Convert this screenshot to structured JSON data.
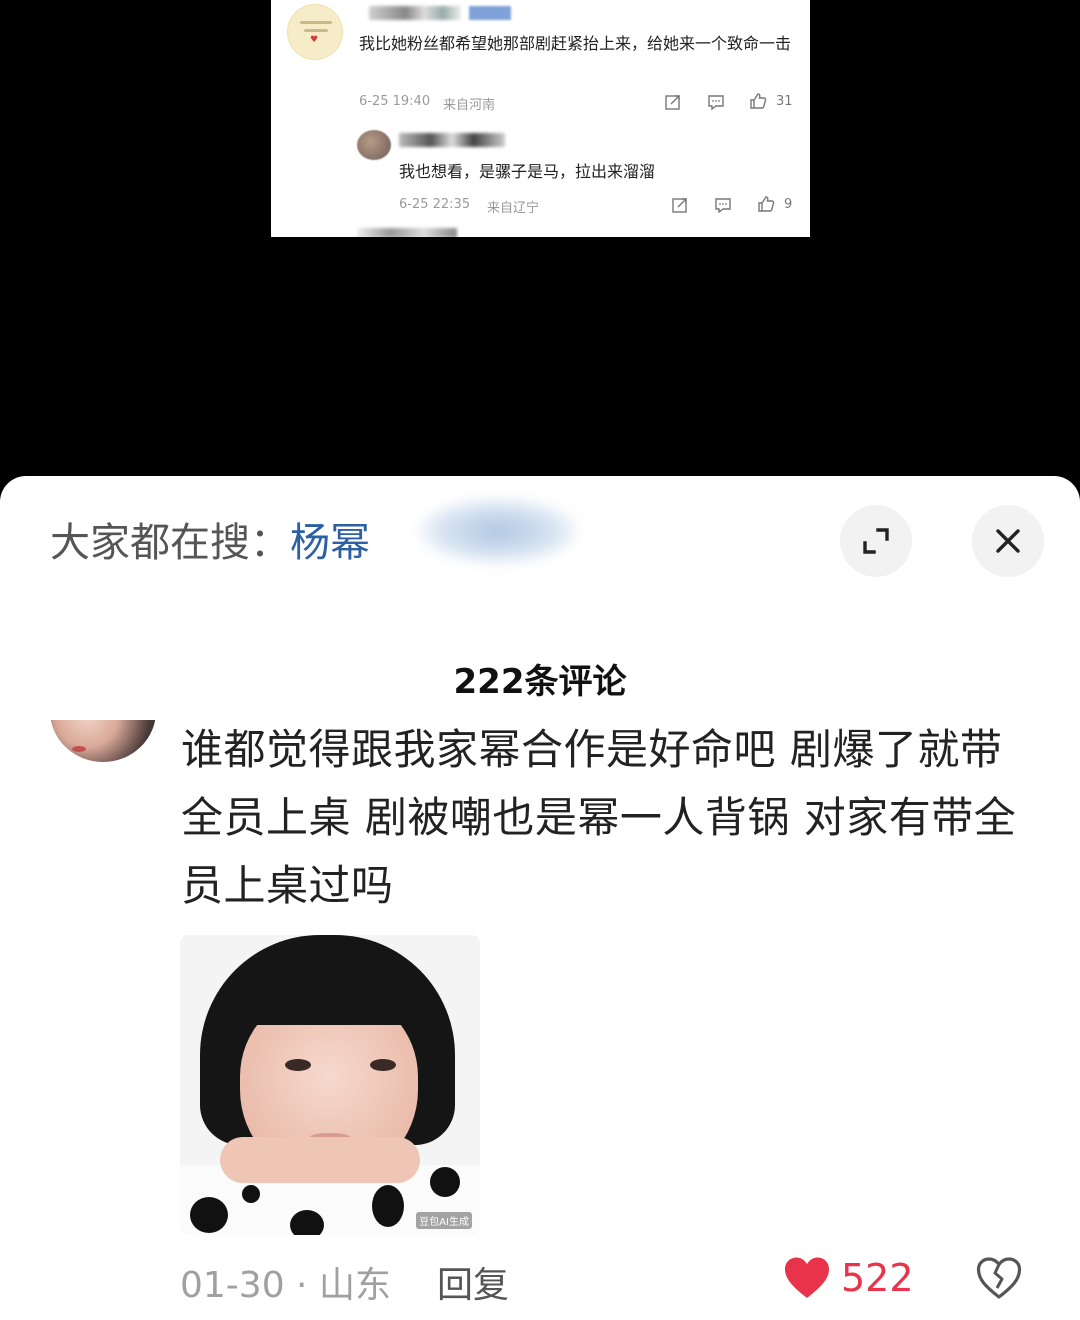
{
  "embedded_screenshot": {
    "comment1": {
      "text": "我比她粉丝都希望她那部剧赶紧抬上来，给她来一个致命一击",
      "date": "6-25 19:40",
      "location": "来自河南",
      "likes": "31"
    },
    "comment2": {
      "text": "我也想看，是骡子是马，拉出来溜溜",
      "date": "6-25 22:35",
      "location": "来自辽宁",
      "likes": "9"
    }
  },
  "search_bar": {
    "prefix": "大家都在搜：",
    "term": "杨幂",
    "expand_icon": "expand-icon",
    "close_icon": "close-icon"
  },
  "comments_header": {
    "title": "222条评论"
  },
  "comment": {
    "text": "谁都觉得跟我家幂合作是好命吧  剧爆了就带全员上桌  剧被嘲也是幂一人背锅  对家有带全员上桌过吗",
    "image_tag": "豆包AI生成",
    "date_location": "01-30 · 山东",
    "reply_label": "回复",
    "like_count": "522",
    "like_icon": "heart-icon",
    "dislike_icon": "broken-heart-icon",
    "like_color": "#e8334a"
  }
}
